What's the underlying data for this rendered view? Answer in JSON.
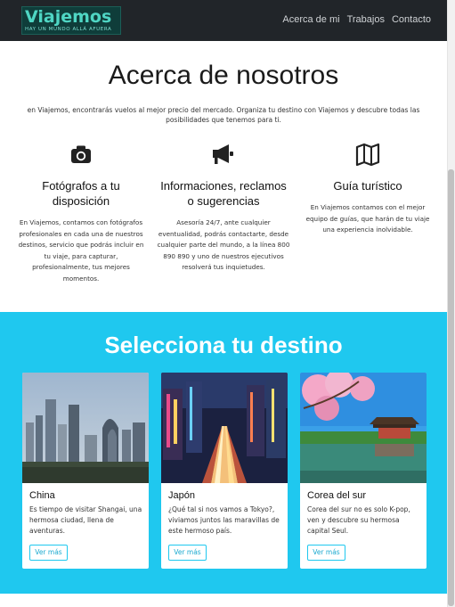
{
  "navbar": {
    "logo_text": "Viajemos",
    "logo_tagline": "HAY UN MUNDO ALLÁ AFUERA",
    "links": [
      "Acerca de mi",
      "Trabajos",
      "Contacto"
    ]
  },
  "about": {
    "title": "Acerca de nosotros",
    "description": "en Viajemos, encontrarás vuelos al mejor precio del mercado. Organiza tu destino con Viajemos y descubre todas las posibilidades que tenemos para ti.",
    "features": [
      {
        "icon": "camera-icon",
        "title": "Fotógrafos a tu disposición",
        "text": "En Viajemos, contamos con fotógrafos profesionales en cada una de nuestros destinos, servicio que podrás incluir en tu viaje, para capturar, profesionalmente, tus mejores momentos."
      },
      {
        "icon": "megaphone-icon",
        "title": "Informaciones, reclamos o sugerencias",
        "text": "Asesoría 24/7, ante cualquier eventualidad, podrás contactarte, desde cualquier parte del mundo, a la línea 800 890 890 y uno de nuestros ejecutivos resolverá tus inquietudes."
      },
      {
        "icon": "map-icon",
        "title": "Guía turístico",
        "text": "En Viajemos contamos con el mejor equipo de guías, que harán de tu viaje una experiencia inolvidable."
      }
    ]
  },
  "destinations": {
    "title": "Selecciona tu destino",
    "cards": [
      {
        "title": "China",
        "text": "Es tiempo de visitar Shangai, una hermosa ciudad, llena de aventuras.",
        "button": "Ver más"
      },
      {
        "title": "Japón",
        "text": "¿Qué tal si nos vamos a Tokyo?, viviamos juntos las maravillas de este hermoso país.",
        "button": "Ver más"
      },
      {
        "title": "Corea del sur",
        "text": "Corea del sur no es solo K-pop, ven y descubre su hermosa capital Seul.",
        "button": "Ver más"
      }
    ]
  }
}
